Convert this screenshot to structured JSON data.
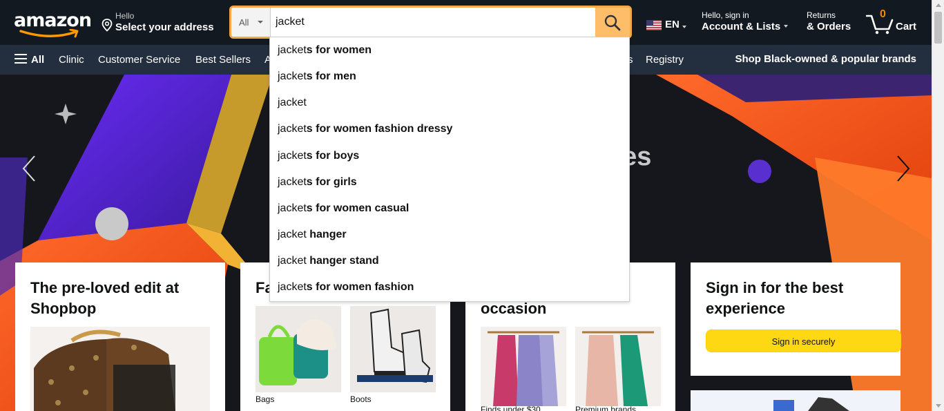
{
  "header": {
    "logo_text": "amazon",
    "address": {
      "line1": "Hello",
      "line2": "Select your address"
    },
    "search": {
      "category": "All",
      "query": "jacket"
    },
    "language": "EN",
    "account": {
      "line1": "Hello, sign in",
      "line2": "Account & Lists"
    },
    "orders": {
      "line1": "Returns",
      "line2": "& Orders"
    },
    "cart": {
      "count": "0",
      "label": "Cart"
    }
  },
  "subnav": {
    "all_label": "All",
    "links": [
      "Clinic",
      "Customer Service",
      "Best Sellers",
      "A",
      "s",
      "Registry"
    ],
    "promo": "Shop Black-owned & popular brands"
  },
  "hero": {
    "partial_text": "ses"
  },
  "suggestions": [
    {
      "typed": "jacket",
      "completion": "s for women"
    },
    {
      "typed": "jacket",
      "completion": "s for men"
    },
    {
      "typed": "jacket",
      "completion": ""
    },
    {
      "typed": "jacket",
      "completion": "s for women fashion dressy"
    },
    {
      "typed": "jacket",
      "completion": "s for boys"
    },
    {
      "typed": "jacket",
      "completion": "s for girls"
    },
    {
      "typed": "jacket",
      "completion": "s for women casual"
    },
    {
      "typed": "jacket",
      "completion": " hanger"
    },
    {
      "typed": "jacket",
      "completion": " hanger stand"
    },
    {
      "typed": "jacket",
      "completion": "s for women fashion"
    }
  ],
  "cards": {
    "shopbop": {
      "title": "The pre-loved edit at Shopbop"
    },
    "fashion": {
      "title_partial": "Fa",
      "tiles": [
        "Bags",
        "Boots"
      ]
    },
    "occasion": {
      "title_partial": "occasion",
      "tiles": [
        "Finds under $30",
        "Premium brands"
      ]
    },
    "signin": {
      "title": "Sign in for the best experience",
      "button": "Sign in securely"
    }
  },
  "colors": {
    "nav_bg": "#131921",
    "subnav_bg": "#232f3e",
    "search_button": "#febd69",
    "search_focus": "#f3a847",
    "cart_count": "#f08804",
    "signin_button": "#ffd814"
  }
}
